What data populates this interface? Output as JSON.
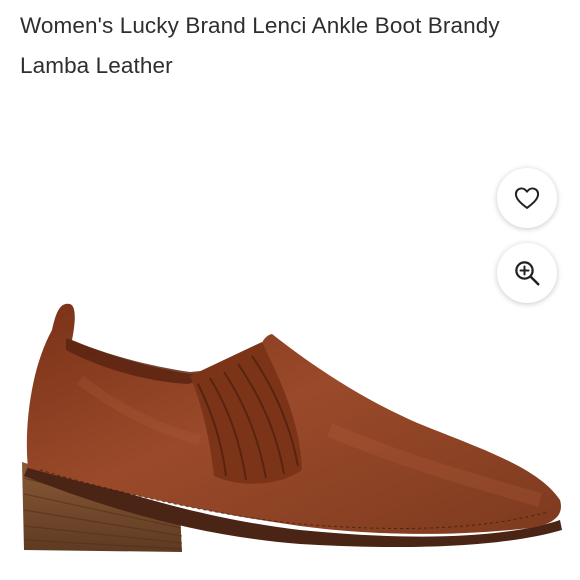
{
  "product": {
    "title": "Women's Lucky Brand Lenci Ankle Boot Brandy Lamba Leather",
    "image_alt": "Brown leather slip-on ankle boot with stacked heel"
  },
  "actions": {
    "favorite_icon": "heart-icon",
    "zoom_icon": "zoom-in-icon"
  },
  "colors": {
    "leather": "#8a3f22",
    "heel": "#7a4a2c",
    "text": "#2e2e2e"
  }
}
